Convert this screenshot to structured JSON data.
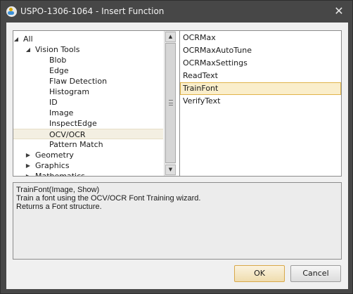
{
  "window": {
    "title": "USPO-1306-1064 - Insert Function",
    "close_glyph": "✕"
  },
  "tree": {
    "items": [
      {
        "label": "All",
        "arrow": "◢",
        "level": 0
      },
      {
        "label": "Vision Tools",
        "arrow": "◢",
        "level": 1
      },
      {
        "label": "Blob",
        "arrow": "",
        "level": 2
      },
      {
        "label": "Edge",
        "arrow": "",
        "level": 2
      },
      {
        "label": "Flaw Detection",
        "arrow": "",
        "level": 2
      },
      {
        "label": "Histogram",
        "arrow": "",
        "level": 2
      },
      {
        "label": "ID",
        "arrow": "",
        "level": 2
      },
      {
        "label": "Image",
        "arrow": "",
        "level": 2
      },
      {
        "label": "InspectEdge",
        "arrow": "",
        "level": 2
      },
      {
        "label": "OCV/OCR",
        "arrow": "",
        "level": 2,
        "selected": true
      },
      {
        "label": "Pattern Match",
        "arrow": "",
        "level": 2
      },
      {
        "label": "Geometry",
        "arrow": "▶",
        "level": 1
      },
      {
        "label": "Graphics",
        "arrow": "▶",
        "level": 1
      },
      {
        "label": "Mathematics",
        "arrow": "▶",
        "level": 1
      }
    ]
  },
  "functions": {
    "items": [
      {
        "label": "OCRMax"
      },
      {
        "label": "OCRMaxAutoTune"
      },
      {
        "label": "OCRMaxSettings"
      },
      {
        "label": "ReadText"
      },
      {
        "label": "TrainFont",
        "selected": true
      },
      {
        "label": "VerifyText"
      }
    ]
  },
  "description": {
    "lines": [
      "TrainFont(Image, Show)",
      "Train a font using the OCV/OCR Font Training wizard.",
      "Returns a Font structure."
    ]
  },
  "buttons": {
    "ok_label": "OK",
    "cancel_label": "Cancel"
  },
  "icons": {
    "app": "cognex-app-icon",
    "close": "close-icon",
    "expanded": "expanded-arrow-icon",
    "collapsed": "collapsed-arrow-icon",
    "scroll_up": "scroll-up-icon",
    "scroll_down": "scroll-down-icon"
  },
  "colors": {
    "title_bar": "#474747",
    "selection_fill": "#faeecb",
    "selection_border": "#e0b44a"
  }
}
